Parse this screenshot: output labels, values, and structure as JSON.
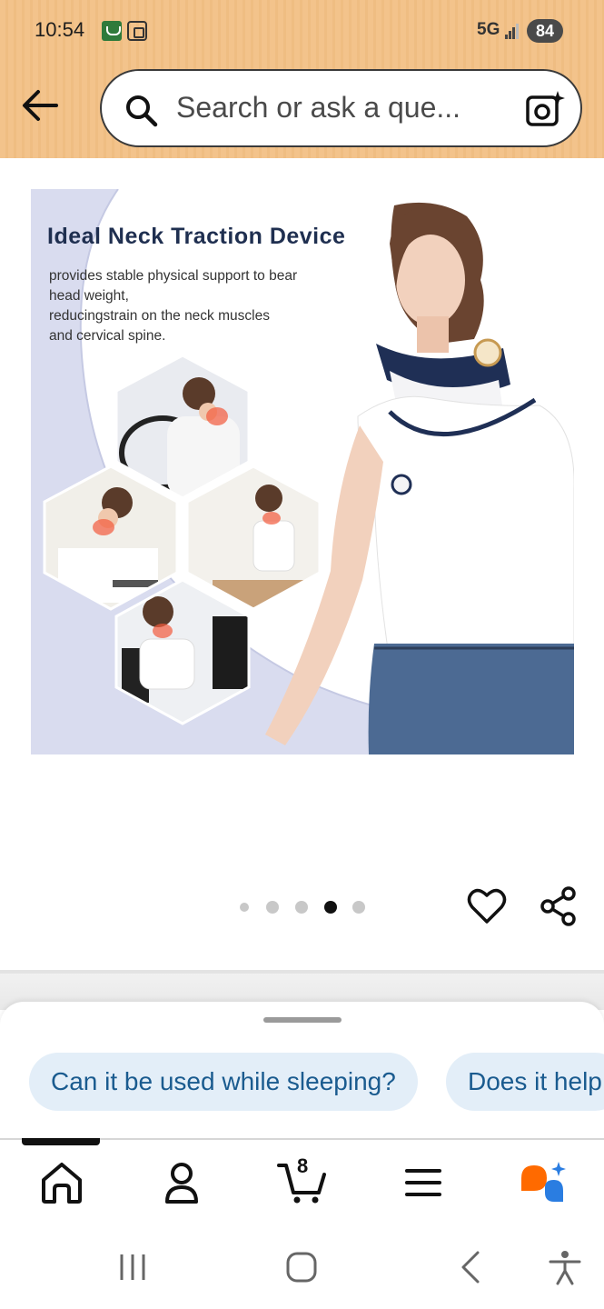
{
  "status_bar": {
    "time": "10:54",
    "network": "5G",
    "battery": "84"
  },
  "search": {
    "placeholder": "Search or ask a que..."
  },
  "product_image": {
    "title": "Ideal Neck Traction Device",
    "description_lines": [
      "provides stable physical support to bear",
      "head weight,",
      "reducingstrain on the neck muscles",
      "and cervical spine."
    ]
  },
  "carousel": {
    "total_dots": 5,
    "active_index": 3
  },
  "suggestions": [
    {
      "label": "Can it be used while sleeping?"
    },
    {
      "label": "Does it help"
    }
  ],
  "bottom_nav": {
    "items": [
      "home-icon",
      "account-icon",
      "cart-icon",
      "menu-icon",
      "rufus-ai-icon"
    ],
    "cart_count": "8",
    "active_item": "home-icon"
  },
  "colors": {
    "header_bg": "#f3c38b",
    "chip_bg": "#e3eef8",
    "chip_text": "#1a5b8f",
    "rufus_orange": "#ff6a00",
    "rufus_blue": "#2a7de1"
  }
}
